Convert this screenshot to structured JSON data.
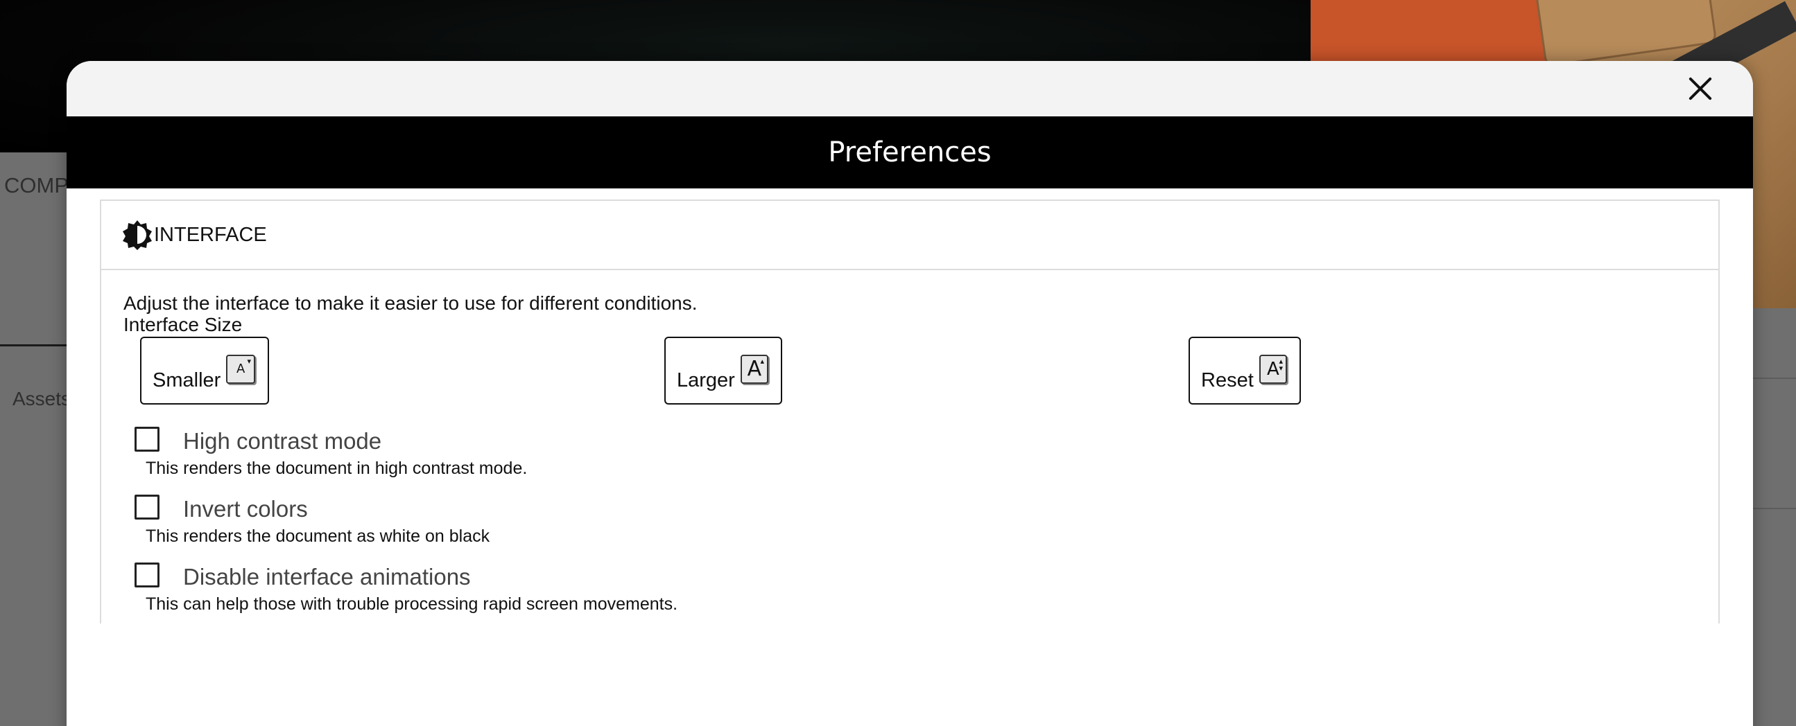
{
  "background": {
    "left_heading": "COMP",
    "left_tab": "Assets"
  },
  "modal": {
    "title": "Preferences",
    "close_icon": "close-icon",
    "section": {
      "title": "INTERFACE",
      "icon": "brightness-contrast-icon",
      "description": "Adjust the interface to make it easier to use for different conditions.",
      "size_label": "Interface Size",
      "buttons": [
        {
          "label": "Smaller",
          "icon": "text-smaller-icon"
        },
        {
          "label": "Larger",
          "icon": "text-larger-icon"
        },
        {
          "label": "Reset",
          "icon": "text-reset-icon"
        }
      ],
      "options": [
        {
          "label": "High contrast mode",
          "hint": "This renders the document in high contrast mode.",
          "checked": false
        },
        {
          "label": "Invert colors",
          "hint": "This renders the document as white on black",
          "checked": false
        },
        {
          "label": "Disable interface animations",
          "hint": "This can help those with trouble processing rapid screen movements.",
          "checked": false
        }
      ]
    }
  }
}
